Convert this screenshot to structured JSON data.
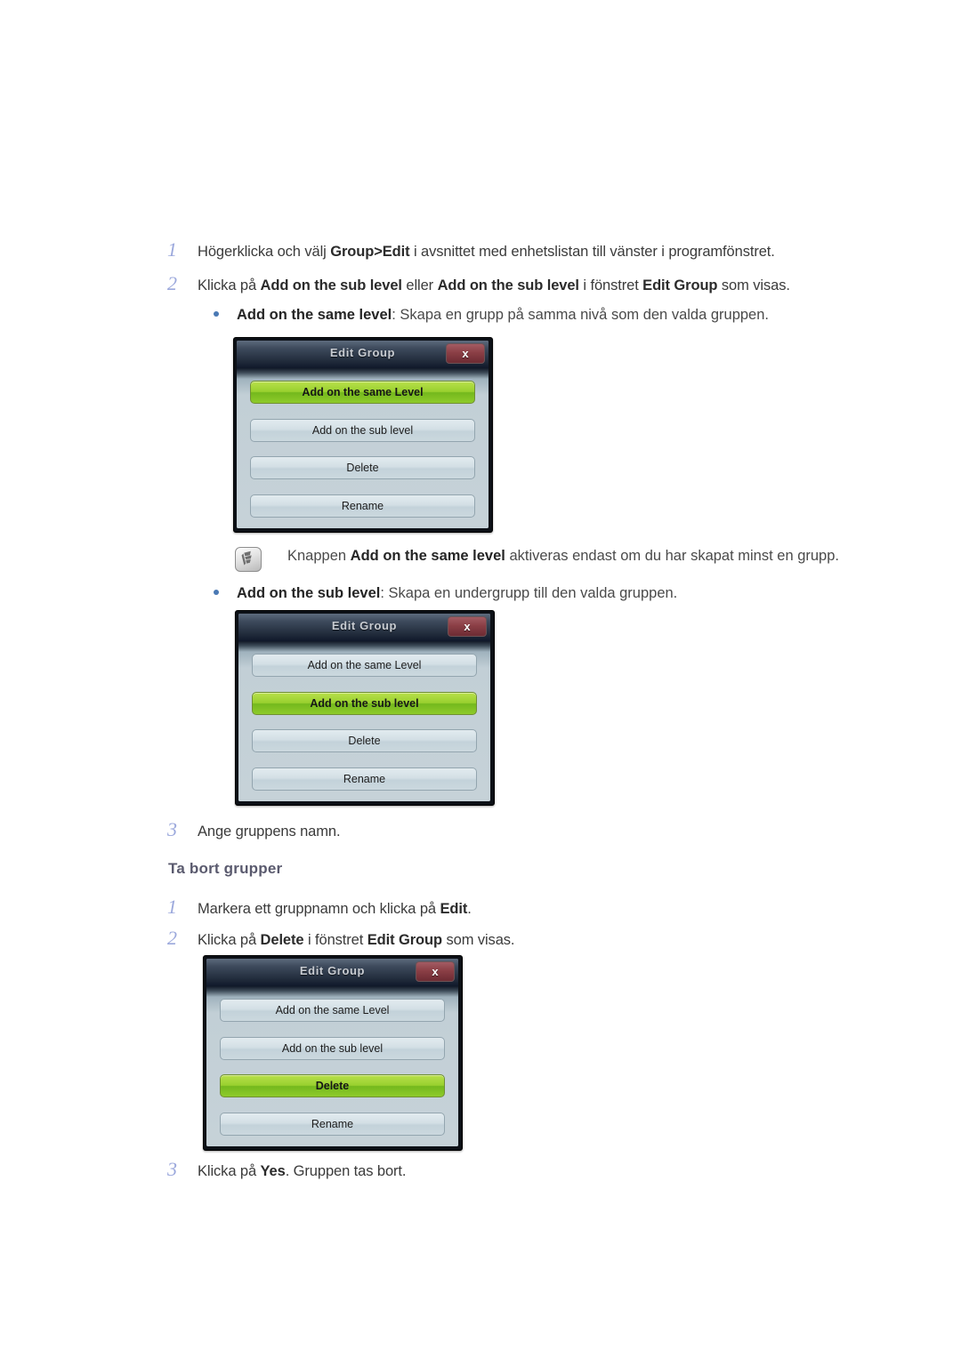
{
  "page": {
    "steps_create": [
      {
        "num": "1",
        "parts": [
          {
            "t": "Högerklicka och välj ",
            "b": false
          },
          {
            "t": "Group>Edit",
            "b": true
          },
          {
            "t": " i avsnittet med enhetslistan till vänster i programfönstret.",
            "b": false
          }
        ]
      },
      {
        "num": "2",
        "parts": [
          {
            "t": "Klicka på ",
            "b": false
          },
          {
            "t": "Add on the sub level",
            "b": true
          },
          {
            "t": " eller ",
            "b": false
          },
          {
            "t": "Add on the sub level",
            "b": true
          },
          {
            "t": " i fönstret ",
            "b": false
          },
          {
            "t": "Edit Group",
            "b": true
          },
          {
            "t": " som visas.",
            "b": false
          }
        ]
      },
      {
        "num": "3",
        "parts": [
          {
            "t": "Ange gruppens namn.",
            "b": false
          }
        ]
      }
    ],
    "bullet_same_level": [
      {
        "t": "Add on the same level",
        "b": true
      },
      {
        "t": ": Skapa en grupp på samma nivå som den valda gruppen.",
        "b": false
      }
    ],
    "bullet_sub_level": [
      {
        "t": "Add on the sub level",
        "b": true
      },
      {
        "t": ": Skapa en undergrupp till den valda gruppen.",
        "b": false
      }
    ],
    "note": {
      "icon": "note-pencil-icon",
      "parts": [
        {
          "t": "Knappen ",
          "b": false
        },
        {
          "t": "Add on the same level",
          "b": true
        },
        {
          "t": " aktiveras endast om du har skapat minst en grupp.",
          "b": false
        }
      ]
    },
    "section_heading": "Ta bort grupper",
    "steps_delete": [
      {
        "num": "1",
        "parts": [
          {
            "t": "Markera ett gruppnamn och klicka på ",
            "b": false
          },
          {
            "t": "Edit",
            "b": true
          },
          {
            "t": ".",
            "b": false
          }
        ]
      },
      {
        "num": "2",
        "parts": [
          {
            "t": "Klicka på ",
            "b": false
          },
          {
            "t": "Delete",
            "b": true
          },
          {
            "t": " i fönstret ",
            "b": false
          },
          {
            "t": "Edit Group",
            "b": true
          },
          {
            "t": " som visas.",
            "b": false
          }
        ]
      },
      {
        "num": "3",
        "parts": [
          {
            "t": "Klicka på ",
            "b": false
          },
          {
            "t": "Yes",
            "b": true
          },
          {
            "t": ". Gruppen tas bort.",
            "b": false
          }
        ]
      }
    ]
  },
  "dialogs": [
    {
      "title": "Edit Group",
      "close_label": "x",
      "close_icon": "close-icon",
      "buttons": [
        {
          "label": "Add on the same Level",
          "active": true
        },
        {
          "label": "Add on the sub level",
          "active": false
        },
        {
          "label": "Delete",
          "active": false
        },
        {
          "label": "Rename",
          "active": false
        }
      ]
    },
    {
      "title": "Edit Group",
      "close_label": "x",
      "close_icon": "close-icon",
      "buttons": [
        {
          "label": "Add on the same Level",
          "active": false
        },
        {
          "label": "Add on the sub level",
          "active": true
        },
        {
          "label": "Delete",
          "active": false
        },
        {
          "label": "Rename",
          "active": false
        }
      ]
    },
    {
      "title": "Edit Group",
      "close_label": "x",
      "close_icon": "close-icon",
      "buttons": [
        {
          "label": "Add on the same Level",
          "active": false
        },
        {
          "label": "Add on the sub level",
          "active": false
        },
        {
          "label": "Delete",
          "active": true
        },
        {
          "label": "Rename",
          "active": false
        }
      ]
    }
  ],
  "colors": {
    "step_number": "#9ba8dc",
    "bullet_dot": "#4a79b4",
    "body_text": "#3b3b3b",
    "heading": "#5a5a6e",
    "dialog_title_bar": "#222d3d",
    "dialog_body": "#c6d2d8",
    "active_button_green": "#98d02e",
    "close_button_red": "#8b3f46"
  }
}
